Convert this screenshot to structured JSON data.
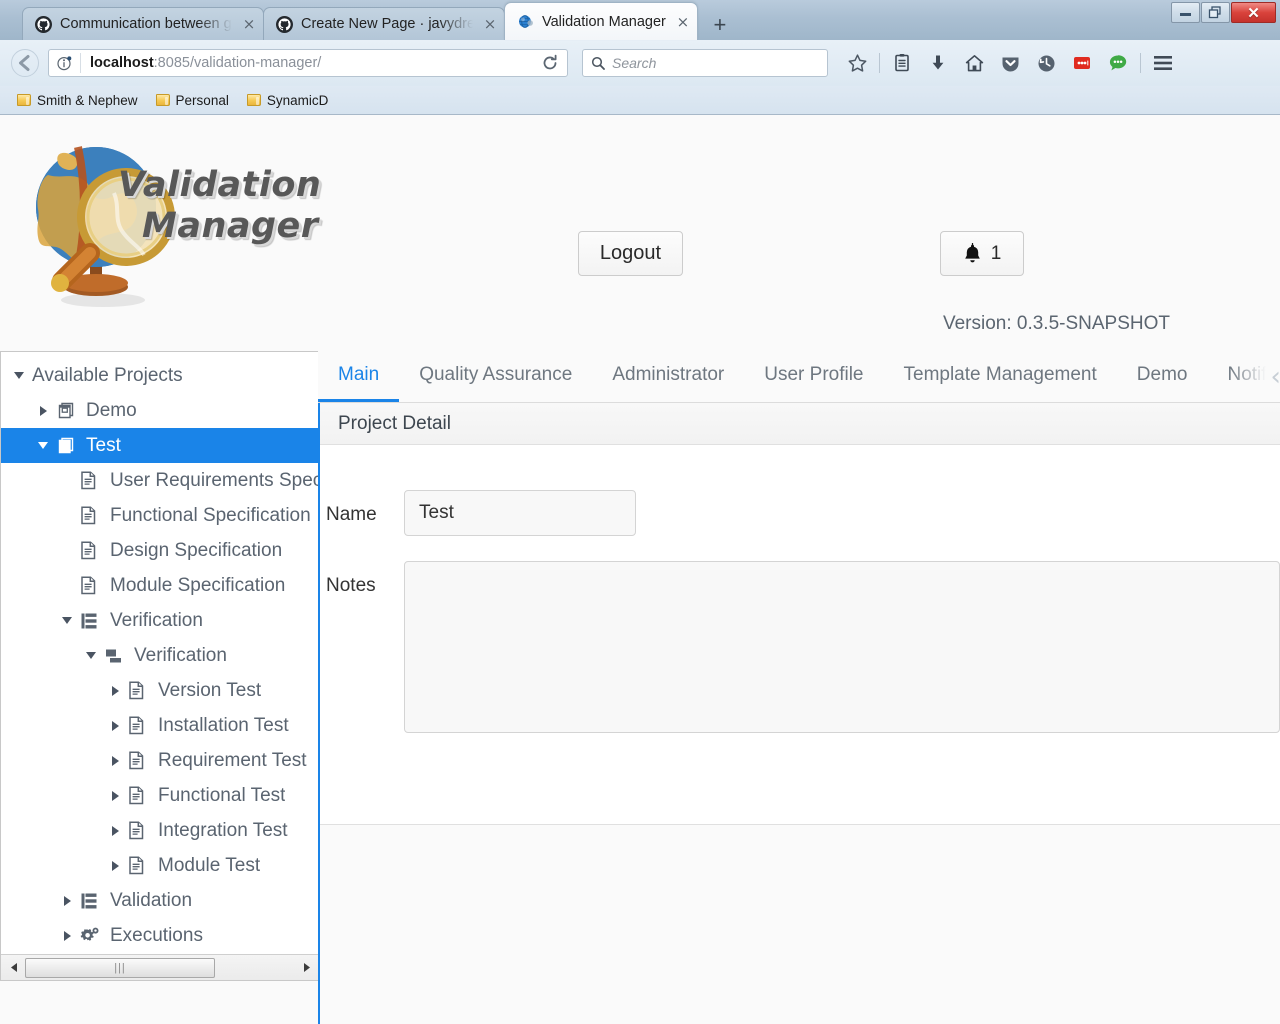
{
  "browser": {
    "tabs": [
      {
        "title": "Communication between gro",
        "favicon": "github-icon",
        "active": false
      },
      {
        "title": "Create New Page · javydream",
        "favicon": "github-icon",
        "active": false
      },
      {
        "title": "Validation Manager",
        "favicon": "globe-icon",
        "active": true
      }
    ],
    "new_tab_label": "+",
    "close_label": "×",
    "window_controls": {
      "minimize": "—",
      "restore": "❐",
      "close": "✕"
    },
    "url": {
      "host": "localhost",
      "rest": ":8085/validation-manager/"
    },
    "search_placeholder": "Search",
    "toolbar_icons": [
      "bookmark-star-icon",
      "reading-list-icon",
      "downloads-icon",
      "home-icon",
      "pocket-icon",
      "history-icon",
      "adblock-icon",
      "chat-icon",
      "menu-icon"
    ],
    "bookmarks": [
      {
        "label": "Smith & Nephew"
      },
      {
        "label": "Personal"
      },
      {
        "label": "SynamicD"
      }
    ]
  },
  "app": {
    "logo_line1": "Validation",
    "logo_line2": "Manager",
    "logout_label": "Logout",
    "notification_count": "1",
    "version": "Version: 0.3.5-SNAPSHOT"
  },
  "tree": {
    "nodes": [
      {
        "label": "Available Projects",
        "indent": 0,
        "twisty": "down",
        "icon": "none",
        "selected": false
      },
      {
        "label": "Demo",
        "indent": 1,
        "twisty": "right",
        "icon": "project-icon",
        "selected": false
      },
      {
        "label": "Test",
        "indent": 1,
        "twisty": "down",
        "icon": "project-icon",
        "selected": true
      },
      {
        "label": "User Requirements Specification",
        "indent": 2,
        "twisty": "none",
        "icon": "document-icon",
        "selected": false
      },
      {
        "label": "Functional Specification",
        "indent": 2,
        "twisty": "none",
        "icon": "document-icon",
        "selected": false
      },
      {
        "label": "Design Specification",
        "indent": 2,
        "twisty": "none",
        "icon": "document-icon",
        "selected": false
      },
      {
        "label": "Module Specification",
        "indent": 2,
        "twisty": "none",
        "icon": "document-icon",
        "selected": false
      },
      {
        "label": "Verification",
        "indent": 2,
        "twisty": "down",
        "icon": "hierarchy-icon",
        "selected": false
      },
      {
        "label": "Verification",
        "indent": 3,
        "twisty": "down",
        "icon": "sub-hierarchy-icon",
        "selected": false
      },
      {
        "label": "Version Test",
        "indent": 4,
        "twisty": "right",
        "icon": "test-doc-icon",
        "selected": false
      },
      {
        "label": "Installation Test",
        "indent": 4,
        "twisty": "right",
        "icon": "test-doc-icon",
        "selected": false
      },
      {
        "label": "Requirement Test",
        "indent": 4,
        "twisty": "right",
        "icon": "test-doc-icon",
        "selected": false
      },
      {
        "label": "Functional Test",
        "indent": 4,
        "twisty": "right",
        "icon": "test-doc-icon",
        "selected": false
      },
      {
        "label": "Integration Test",
        "indent": 4,
        "twisty": "right",
        "icon": "test-doc-icon",
        "selected": false
      },
      {
        "label": "Module Test",
        "indent": 4,
        "twisty": "right",
        "icon": "test-doc-icon",
        "selected": false
      },
      {
        "label": "Validation",
        "indent": 2,
        "twisty": "right",
        "icon": "hierarchy-icon",
        "selected": false
      },
      {
        "label": "Executions",
        "indent": 2,
        "twisty": "right",
        "icon": "gears-icon",
        "selected": false
      }
    ]
  },
  "tabs": {
    "items": [
      {
        "label": "Main",
        "active": true,
        "truncated": false
      },
      {
        "label": "Quality Assurance",
        "active": false,
        "truncated": false
      },
      {
        "label": "Administrator",
        "active": false,
        "truncated": false
      },
      {
        "label": "User Profile",
        "active": false,
        "truncated": false
      },
      {
        "label": "Template Management",
        "active": false,
        "truncated": false
      },
      {
        "label": "Demo",
        "active": false,
        "truncated": false
      },
      {
        "label": "Notif",
        "active": false,
        "truncated": true
      }
    ],
    "scroll_left": "‹",
    "scroll_right": "›"
  },
  "panel": {
    "title": "Project Detail",
    "name_label": "Name",
    "name_value": "Test",
    "notes_label": "Notes",
    "notes_value": ""
  }
}
